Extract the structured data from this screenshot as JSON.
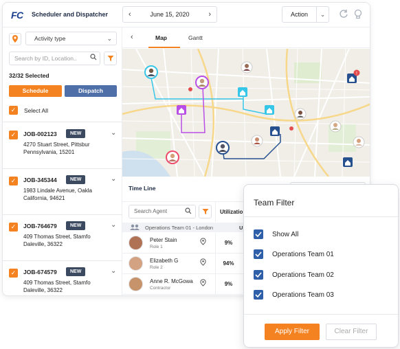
{
  "header": {
    "logo": "FC",
    "app_title": "Scheduler and Dispatcher",
    "date": "June 15, 2020",
    "action_label": "Action"
  },
  "sidebar": {
    "activity_type": "Activity type",
    "search_placeholder": "Search by ID, Location..",
    "selected_count": "32/32 Selected",
    "schedule_label": "Schedule",
    "dispatch_label": "Dispatch",
    "select_all_label": "Select All",
    "jobs": [
      {
        "id": "JOB-002123",
        "badge": "NEW",
        "address": "4270 Stuart Street, Pittsbur Pennsylvania, 15201"
      },
      {
        "id": "JOB-345344",
        "badge": "NEW",
        "address": "1983 Lindale Avenue, Oakla California, 94621"
      },
      {
        "id": "JOB-764679",
        "badge": "NEW",
        "address": "409 Thomas Street, Stamfo Daleville, 36322"
      },
      {
        "id": "JOB-674579",
        "badge": "NEW",
        "address": "409 Thomas Street, Stamfo Daleville, 36322"
      }
    ]
  },
  "main": {
    "tabs": [
      {
        "label": "Map",
        "active": true
      },
      {
        "label": "Gantt",
        "active": false
      }
    ],
    "timeline_label": "Time Line",
    "agent_search_placeholder": "Search Agent",
    "utilization_header": "Utilizatio",
    "team_row": {
      "name": "Operations Team 01",
      "location": "London",
      "col": "U"
    },
    "agents": [
      {
        "name": "Peter Stain",
        "role": "Role 1",
        "utilization": "9%"
      },
      {
        "name": "Elizabeth G",
        "role": "Role 2",
        "utilization": "94%"
      },
      {
        "name": "Anne R. McGowa",
        "role": "Contractor",
        "utilization": "9%"
      }
    ]
  },
  "team_filter": {
    "title": "Team Filter",
    "options": [
      {
        "label": "Show All",
        "checked": true
      },
      {
        "label": "Operations Team 01",
        "checked": true
      },
      {
        "label": "Operations Team 02",
        "checked": true
      },
      {
        "label": "Operations Team 03",
        "checked": true
      }
    ],
    "apply_label": "Apply Filter",
    "clear_label": "Clear Filter"
  },
  "colors": {
    "accent": "#f58220",
    "brand": "#1a3e8c",
    "dispatch": "#4f6fa8",
    "checkbox_blue": "#2f5fa8",
    "badge": "#3b4a61"
  }
}
